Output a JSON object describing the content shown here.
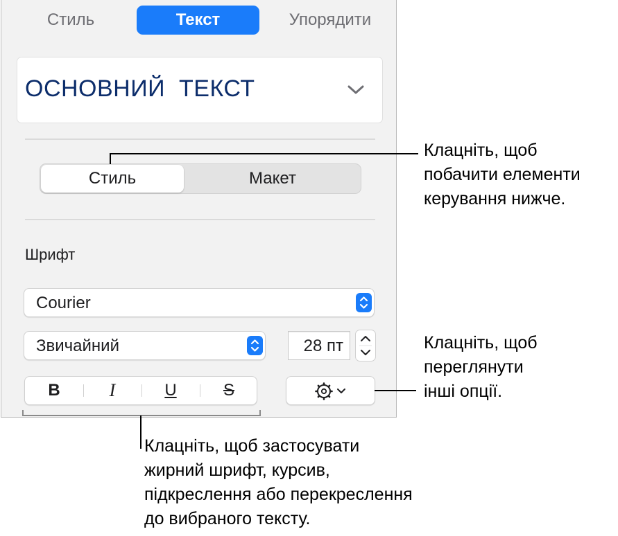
{
  "tabs": [
    {
      "label": "Стиль",
      "active": false
    },
    {
      "label": "Текст",
      "active": true
    },
    {
      "label": "Упорядити",
      "active": false
    }
  ],
  "paragraph_style": {
    "value": "ОСНОВНИЙ  ТЕКСТ",
    "icon": "chevron-down-icon"
  },
  "segmented": [
    {
      "label": "Стиль",
      "active": true
    },
    {
      "label": "Макет",
      "active": false
    }
  ],
  "font_section": {
    "label": "Шрифт",
    "font_family": "Courier",
    "font_style": "Звичайний",
    "font_size": "28 пт"
  },
  "format_buttons": [
    {
      "label": "B",
      "name": "bold"
    },
    {
      "label": "I",
      "name": "italic"
    },
    {
      "label": "U",
      "name": "underline"
    },
    {
      "label": "S",
      "name": "strikethrough"
    }
  ],
  "options_button": {
    "icon": "gear-icon"
  },
  "callouts": {
    "segment": [
      "Клацніть, щоб",
      "побачити елементи",
      "керування нижче."
    ],
    "options": [
      "Клацніть, щоб",
      "переглянути",
      "інші опції."
    ],
    "format": [
      "Клацніть, щоб застосувати",
      "жирний шрифт, курсив,",
      "підкреслення або перекреслення",
      "до вибраного тексту."
    ]
  },
  "colors": {
    "accent": "#1a7cfa",
    "panel": "#f2f2f2",
    "style_text": "#0c2d6b"
  }
}
